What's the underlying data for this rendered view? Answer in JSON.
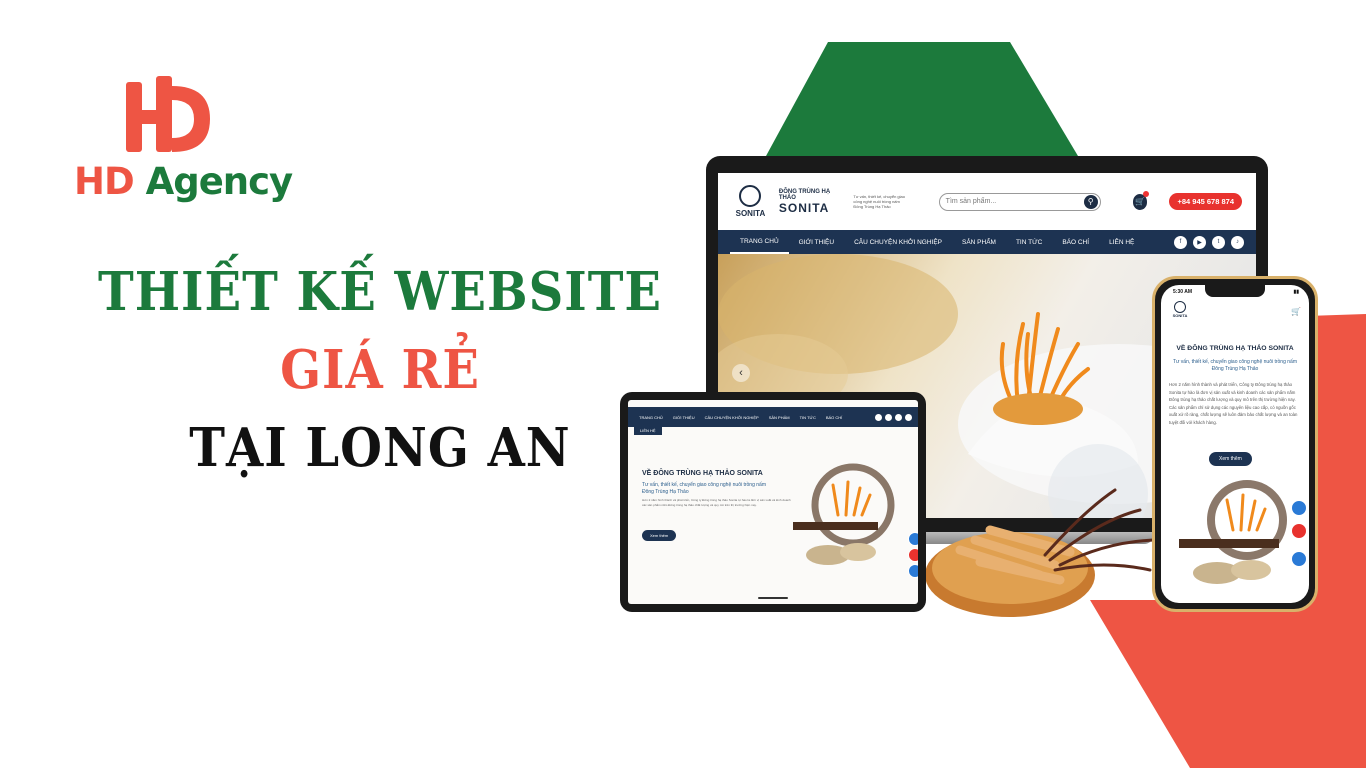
{
  "logo": {
    "part1": "HD",
    "part2": " Agency"
  },
  "headline": {
    "line1": "THIẾT KẾ WEBSITE",
    "line2": "GIÁ RẺ",
    "line3": "TẠI LONG AN"
  },
  "laptop_site": {
    "logo_text": "SONITA",
    "brand_line1": "ĐÔNG TRÙNG HẠ THẢO",
    "brand_line2": "SONITA",
    "tagline": "Tư vấn, thiết kế, chuyển giao công nghệ nuôi trồng nấm Đông Trùng Hạ Thảo",
    "search_placeholder": "Tìm sản phẩm...",
    "phone": "+84 945 678 874",
    "nav": [
      "TRANG CHỦ",
      "GIỚI THIỆU",
      "CÂU CHUYỆN KHỞI NGHIỆP",
      "SẢN PHẨM",
      "TIN TỨC",
      "BÁO CHÍ",
      "LIÊN HỆ"
    ]
  },
  "tablet_site": {
    "nav": [
      "TRANG CHỦ",
      "GIỚI THIỆU",
      "CÂU CHUYỆN KHỞI NGHIỆP",
      "SẢN PHẨM",
      "TIN TỨC",
      "BÁO CHÍ"
    ],
    "nav2": "LIÊN HỆ",
    "title": "VỀ ĐÔNG TRÙNG HẠ THẢO SONITA",
    "subtitle": "Tư vấn, thiết kế, chuyển giao công nghệ nuôi trồng nấm Đông Trùng Hạ Thảo",
    "paragraph": "Hơn 2 năm hình thành và phát triển, Công ty Đông trùng hạ thảo Sonita tự hào là đơn vị sản xuất và kinh doanh các sản phẩm nấm Đông trùng hạ thảo chất lượng và quy mô trên thị trường hiện nay.",
    "button": "Xem thêm"
  },
  "phone_site": {
    "time": "5:30 AM",
    "logo_text": "SONITA",
    "title": "VỀ ĐÔNG TRÙNG HẠ THẢO SONITA",
    "subtitle": "Tư vấn, thiết kế, chuyển giao công nghệ nuôi trồng nấm Đông Trùng Hạ Thảo",
    "paragraph": "Hơn 2 năm hình thành và phát triển, Công ty Đông trùng hạ thảo Sonita tự hào là đơn vị sản xuất và kinh doanh các sản phẩm nấm Đông trùng hạ thảo chất lượng và quy mô trên thị trường hiện nay. Các sản phẩm chỉ sử dụng các nguyên liệu cao cấp, có nguồn gốc xuất xứ rõ ràng, chất lượng sẽ luôn đảm bảo chất lượng và an toàn tuyệt đối với khách hàng.",
    "button": "Xem thêm"
  },
  "colors": {
    "brand_green": "#1c7a3c",
    "brand_red": "#ee5544",
    "navy": "#1d3352"
  }
}
